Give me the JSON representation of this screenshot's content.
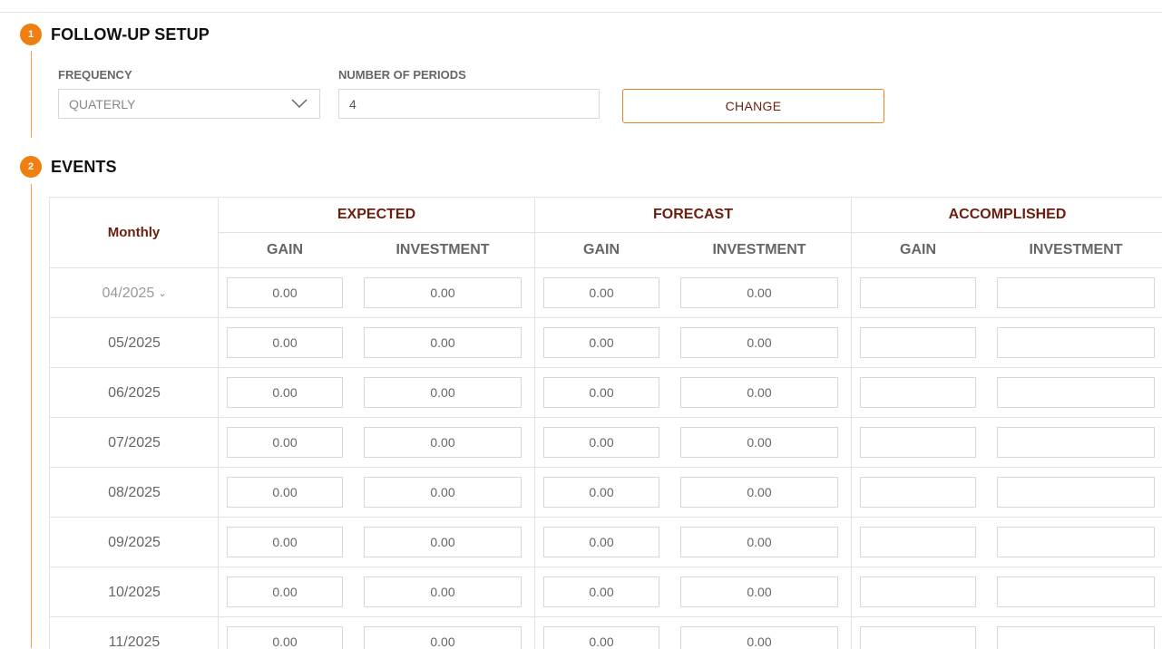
{
  "sections": {
    "setup": {
      "number": "1",
      "title": "FOLLOW-UP SETUP"
    },
    "events": {
      "number": "2",
      "title": "EVENTS"
    }
  },
  "setup": {
    "frequency_label": "FREQUENCY",
    "frequency_value": "QUATERLY",
    "periods_label": "NUMBER OF PERIODS",
    "periods_value": "4",
    "change_label": "CHANGE"
  },
  "table": {
    "period_header": "Monthly",
    "groups": [
      "EXPECTED",
      "FORECAST",
      "ACCOMPLISHED"
    ],
    "subheaders": [
      "GAIN",
      "INVESTMENT",
      "GAIN",
      "INVESTMENT",
      "GAIN",
      "INVESTMENT"
    ],
    "rows": [
      {
        "date": "04/2025",
        "values": [
          "0.00",
          "0.00",
          "0.00",
          "0.00",
          "",
          ""
        ]
      },
      {
        "date": "05/2025",
        "values": [
          "0.00",
          "0.00",
          "0.00",
          "0.00",
          "",
          ""
        ]
      },
      {
        "date": "06/2025",
        "values": [
          "0.00",
          "0.00",
          "0.00",
          "0.00",
          "",
          ""
        ]
      },
      {
        "date": "07/2025",
        "values": [
          "0.00",
          "0.00",
          "0.00",
          "0.00",
          "",
          ""
        ]
      },
      {
        "date": "08/2025",
        "values": [
          "0.00",
          "0.00",
          "0.00",
          "0.00",
          "",
          ""
        ]
      },
      {
        "date": "09/2025",
        "values": [
          "0.00",
          "0.00",
          "0.00",
          "0.00",
          "",
          ""
        ]
      },
      {
        "date": "10/2025",
        "values": [
          "0.00",
          "0.00",
          "0.00",
          "0.00",
          "",
          ""
        ]
      },
      {
        "date": "11/2025",
        "values": [
          "0.00",
          "0.00",
          "0.00",
          "0.00",
          "",
          ""
        ]
      }
    ]
  },
  "colors": {
    "accent": "#f07f12",
    "heading": "#6b1d0e"
  }
}
